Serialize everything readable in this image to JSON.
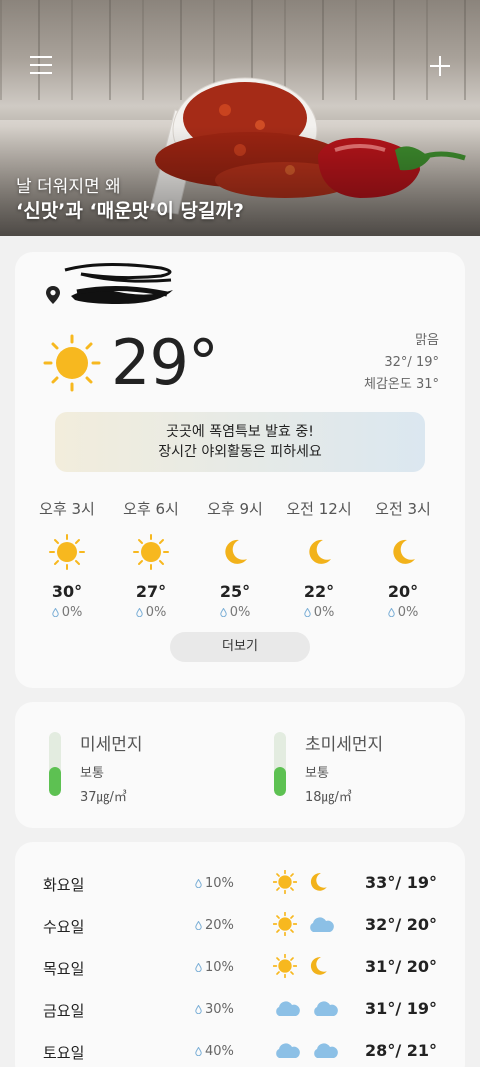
{
  "hero": {
    "subtitle": "날 더워지면 왜",
    "title": "‘신맛’과 ‘매운맛’이 당길까?"
  },
  "current": {
    "temp": "29°",
    "condition": "맑음",
    "high_low": "32°/ 19°",
    "feels_like": "체감온도 31°",
    "icon": "sun-icon"
  },
  "alert": {
    "line1": "곳곳에 폭염특보 발효 중!",
    "line2": "장시간 야외활동은 피하세요"
  },
  "hourly": [
    {
      "time": "오후 3시",
      "icon": "sun-icon",
      "temp": "30°",
      "rain": "0%"
    },
    {
      "time": "오후 6시",
      "icon": "sun-icon",
      "temp": "27°",
      "rain": "0%"
    },
    {
      "time": "오후 9시",
      "icon": "moon-icon",
      "temp": "25°",
      "rain": "0%"
    },
    {
      "time": "오전 12시",
      "icon": "moon-icon",
      "temp": "22°",
      "rain": "0%"
    },
    {
      "time": "오전 3시",
      "icon": "moon-icon",
      "temp": "20°",
      "rain": "0%"
    }
  ],
  "more_label": "더보기",
  "dust": {
    "pm10": {
      "name": "미세먼지",
      "level": "보통",
      "value": "37㎍/㎥",
      "fill_fraction": 0.45
    },
    "pm25": {
      "name": "초미세먼지",
      "level": "보통",
      "value": "18㎍/㎥",
      "fill_fraction": 0.45
    }
  },
  "daily": [
    {
      "day": "화요일",
      "rain": "10%",
      "am": "sun-icon",
      "pm": "moon-icon",
      "temps": "33°/ 19°"
    },
    {
      "day": "수요일",
      "rain": "20%",
      "am": "sun-icon",
      "pm": "cloud-icon",
      "temps": "32°/ 20°"
    },
    {
      "day": "목요일",
      "rain": "10%",
      "am": "sun-icon",
      "pm": "moon-icon",
      "temps": "31°/ 20°"
    },
    {
      "day": "금요일",
      "rain": "30%",
      "am": "cloud-icon",
      "pm": "cloud-icon",
      "temps": "31°/ 19°"
    },
    {
      "day": "토요일",
      "rain": "40%",
      "am": "cloud-icon",
      "pm": "cloud-icon",
      "temps": "28°/ 21°"
    }
  ],
  "colors": {
    "sun": "#f7b81f",
    "moon": "#f2b21a",
    "cloud": "#8cc0e6",
    "dust_fill": "#5dc152",
    "alert_left": "#f2eddc",
    "alert_right": "#dbe7f0"
  }
}
